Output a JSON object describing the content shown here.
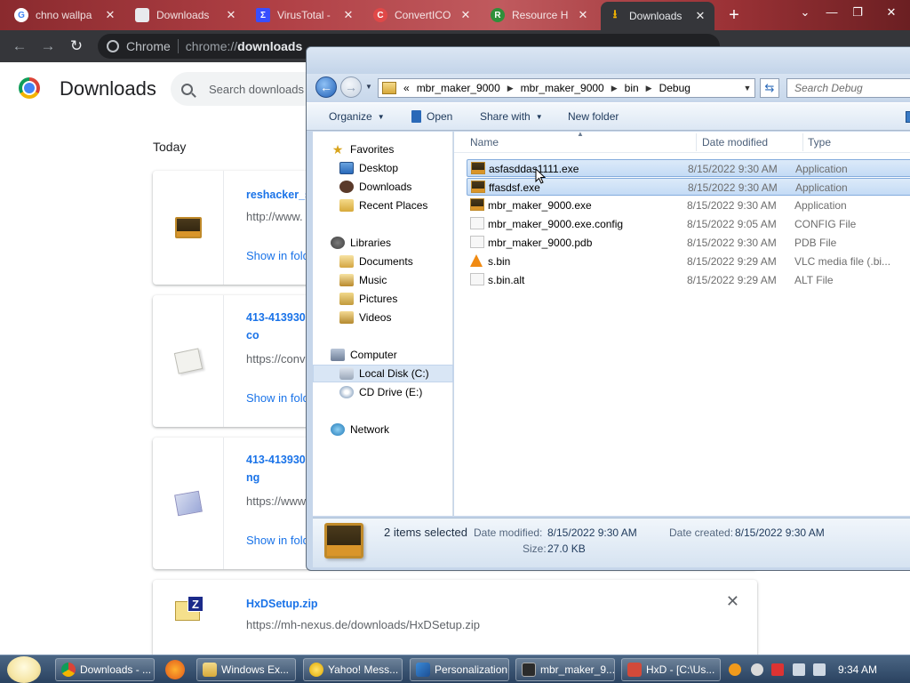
{
  "browser": {
    "tabs": [
      {
        "title": "chno wallpa",
        "active": false,
        "icon": "google-icon"
      },
      {
        "title": "Downloads",
        "active": false,
        "icon": "downloads-page-icon"
      },
      {
        "title": "VirusTotal - ",
        "active": false,
        "icon": "virustotal-icon"
      },
      {
        "title": "ConvertICO",
        "active": false,
        "icon": "converticon-icon"
      },
      {
        "title": "Resource H",
        "active": false,
        "icon": "resource-hacker-icon"
      },
      {
        "title": "Downloads",
        "active": true,
        "icon": "download-arrow-icon"
      }
    ],
    "new_tab_label": "+",
    "omnibox": {
      "site_label": "Chrome",
      "scheme": "chrome://",
      "host": "downloads"
    }
  },
  "downloads_page": {
    "heading": "Downloads",
    "search_placeholder": "Search downloads",
    "date_group": "Today",
    "items": [
      {
        "name": "reshacker_s",
        "url": "http://www.",
        "action": "Show in fold"
      },
      {
        "name": "413-413930",
        "name_line2": "co",
        "url": "https://conv",
        "action": "Show in fold"
      },
      {
        "name": "413-413930",
        "name_line2": "ng",
        "url": "https://www",
        "action": "Show in fold"
      },
      {
        "name": "HxDSetup.zip",
        "url": "https://mh-nexus.de/downloads/HxDSetup.zip",
        "close": "✕"
      }
    ]
  },
  "explorer": {
    "address": {
      "overflow": "«",
      "crumbs": [
        "mbr_maker_9000",
        "mbr_maker_9000",
        "bin",
        "Debug"
      ]
    },
    "search_placeholder": "Search Debug",
    "commands": {
      "organize": "Organize",
      "open": "Open",
      "share": "Share with",
      "new_folder": "New folder"
    },
    "nav": {
      "favorites": "Favorites",
      "desktop": "Desktop",
      "downloads": "Downloads",
      "recent": "Recent Places",
      "libraries": "Libraries",
      "documents": "Documents",
      "music": "Music",
      "pictures": "Pictures",
      "videos": "Videos",
      "computer": "Computer",
      "local_disk": "Local Disk (C:)",
      "cd_drive": "CD Drive (E:)",
      "network": "Network"
    },
    "columns": {
      "name": "Name",
      "date": "Date modified",
      "type": "Type"
    },
    "files": [
      {
        "name": "asfasddas1111.exe",
        "date": "8/15/2022 9:30 AM",
        "type": "Application",
        "selected": true
      },
      {
        "name": "ffasdsf.exe",
        "date": "8/15/2022 9:30 AM",
        "type": "Application",
        "selected": true
      },
      {
        "name": "mbr_maker_9000.exe",
        "date": "8/15/2022 9:30 AM",
        "type": "Application",
        "selected": false
      },
      {
        "name": "mbr_maker_9000.exe.config",
        "date": "8/15/2022 9:05 AM",
        "type": "CONFIG File",
        "selected": false
      },
      {
        "name": "mbr_maker_9000.pdb",
        "date": "8/15/2022 9:30 AM",
        "type": "PDB File",
        "selected": false
      },
      {
        "name": "s.bin",
        "date": "8/15/2022 9:29 AM",
        "type": "VLC media file (.bi...",
        "selected": false
      },
      {
        "name": "s.bin.alt",
        "date": "8/15/2022 9:29 AM",
        "type": "ALT File",
        "selected": false
      }
    ],
    "details": {
      "summary": "2 items selected",
      "modified_label": "Date modified:",
      "modified_value": "8/15/2022 9:30 AM",
      "created_label": "Date created:",
      "created_value": "8/15/2022 9:30 AM",
      "size_label": "Size:",
      "size_value": "27.0 KB"
    }
  },
  "taskbar": {
    "buttons": [
      {
        "label": "Downloads - ...",
        "icon": "chrome-icon"
      },
      {
        "label": "Windows Ex...",
        "icon": "folder-icon"
      },
      {
        "label": "Yahoo! Mess...",
        "icon": "yahoo-messenger-icon"
      },
      {
        "label": "Personalization",
        "icon": "personalization-icon"
      },
      {
        "label": "mbr_maker_9...",
        "icon": "app-icon"
      },
      {
        "label": "HxD - [C:\\Us...",
        "icon": "hxd-icon"
      }
    ],
    "clock": "9:34 AM"
  },
  "colors": {
    "link": "#1a73e8",
    "explorer_selection": "#c4dbf5",
    "chrome_dark": "#35363a"
  }
}
